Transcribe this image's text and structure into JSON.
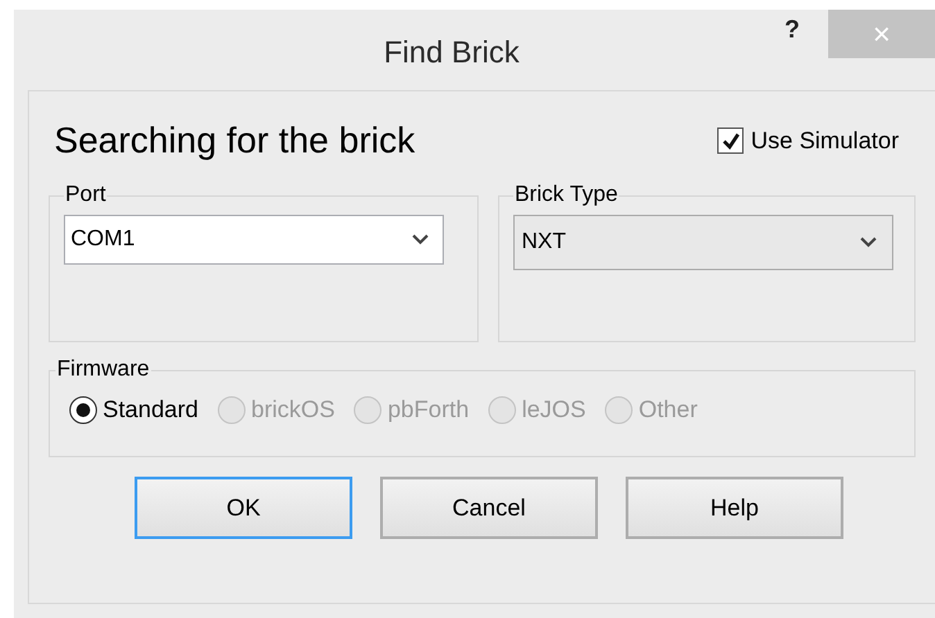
{
  "window": {
    "title": "Find Brick",
    "help_button": "?",
    "close_button": "×"
  },
  "heading": "Searching for the brick",
  "use_simulator": {
    "label": "Use Simulator",
    "checked": true
  },
  "port": {
    "legend": "Port",
    "value": "COM1"
  },
  "brick_type": {
    "legend": "Brick Type",
    "value": "NXT"
  },
  "firmware": {
    "legend": "Firmware",
    "options": [
      {
        "label": "Standard",
        "selected": true,
        "disabled": false
      },
      {
        "label": "brickOS",
        "selected": false,
        "disabled": true
      },
      {
        "label": "pbForth",
        "selected": false,
        "disabled": true
      },
      {
        "label": "leJOS",
        "selected": false,
        "disabled": true
      },
      {
        "label": "Other",
        "selected": false,
        "disabled": true
      }
    ]
  },
  "buttons": [
    {
      "label": "OK",
      "default": true
    },
    {
      "label": "Cancel",
      "default": false
    },
    {
      "label": "Help",
      "default": false
    }
  ]
}
